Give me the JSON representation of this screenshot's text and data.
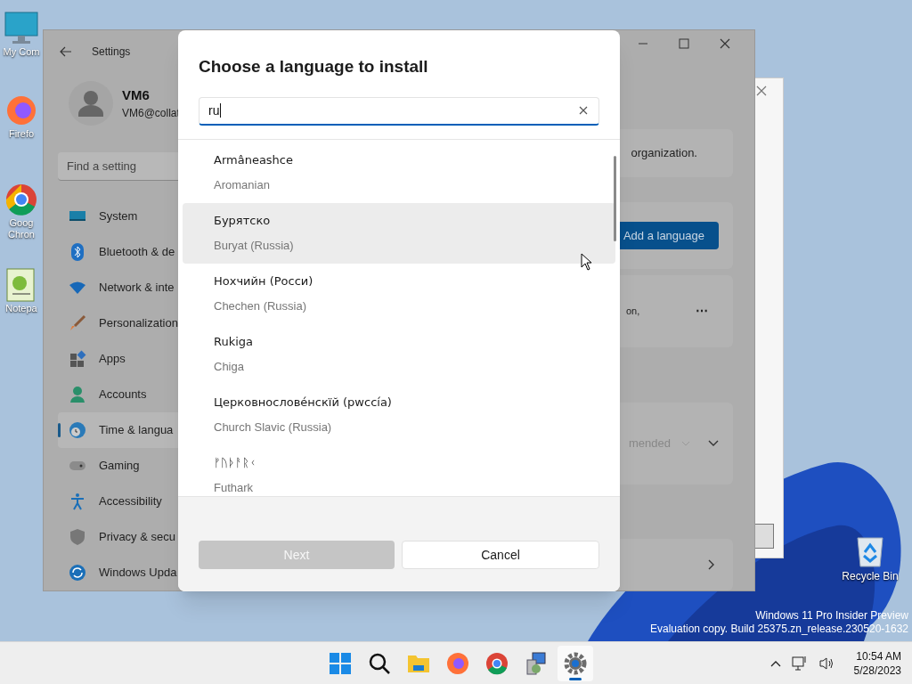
{
  "desktop_icons": [
    {
      "kind": "monitor",
      "label": "My Com"
    },
    {
      "kind": "firefox",
      "label": "Firefo"
    },
    {
      "kind": "chrome",
      "label": "Goog Chron"
    },
    {
      "kind": "notepad",
      "label": "Notepa"
    }
  ],
  "recycle_bin": {
    "label": "Recycle Bin"
  },
  "watermark": {
    "line_1": "Windows 11 Pro Insider Preview",
    "line_2": "Evaluation copy. Build 25375.zn_release.230520-1632"
  },
  "settings": {
    "title": "Settings",
    "user_name": "VM6",
    "user_email": "VM6@collat",
    "search_placeholder": "Find a setting",
    "nav": [
      {
        "kind": "system",
        "label": "System",
        "selected": false
      },
      {
        "kind": "bluetooth",
        "label": "Bluetooth & de",
        "selected": false
      },
      {
        "kind": "network",
        "label": "Network & inte",
        "selected": false
      },
      {
        "kind": "brush",
        "label": "Personalization",
        "selected": false
      },
      {
        "kind": "apps",
        "label": "Apps",
        "selected": false
      },
      {
        "kind": "accounts",
        "label": "Accounts",
        "selected": false
      },
      {
        "kind": "time",
        "label": "Time & langua",
        "selected": true
      },
      {
        "kind": "gaming",
        "label": "Gaming",
        "selected": false
      },
      {
        "kind": "accessibility",
        "label": "Accessibility",
        "selected": false
      },
      {
        "kind": "privacy",
        "label": "Privacy & secu",
        "selected": false
      },
      {
        "kind": "update",
        "label": "Windows Upda",
        "selected": false
      }
    ],
    "content": {
      "notice_text": "organization.",
      "add_language_button": "Add a language",
      "language_text": "on,",
      "more_button": "⋯",
      "dropdown_value": "mended"
    }
  },
  "dialog": {
    "title": "Choose a language to install",
    "search_value": "ru",
    "languages": [
      {
        "native": "Armâneashce",
        "english": "Aromanian",
        "highlighted": false
      },
      {
        "native": "Бурятско",
        "english": "Buryat (Russia)",
        "highlighted": true
      },
      {
        "native": "Нохчийн (Росси)",
        "english": "Chechen (Russia)",
        "highlighted": false
      },
      {
        "native": "Rukiga",
        "english": "Chiga",
        "highlighted": false
      },
      {
        "native": "Церковнослове́нскїй (рwссі́а)",
        "english": "Church Slavic (Russia)",
        "highlighted": false
      },
      {
        "native": "ᚠᚢᚦᚨᚱᚲ",
        "english": "Futhark",
        "highlighted": false
      }
    ],
    "next_button": {
      "label": "Next",
      "disabled": true
    },
    "cancel_button": {
      "label": "Cancel",
      "disabled": false
    }
  },
  "taskbar": {
    "apps": [
      {
        "kind": "start",
        "active": false
      },
      {
        "kind": "search",
        "active": false
      },
      {
        "kind": "folder",
        "active": false
      },
      {
        "kind": "firefox",
        "active": false
      },
      {
        "kind": "chrome",
        "active": false
      },
      {
        "kind": "installer",
        "active": false
      },
      {
        "kind": "settings",
        "active": true
      }
    ],
    "time": "10:54 AM",
    "date": "5/28/2023"
  }
}
